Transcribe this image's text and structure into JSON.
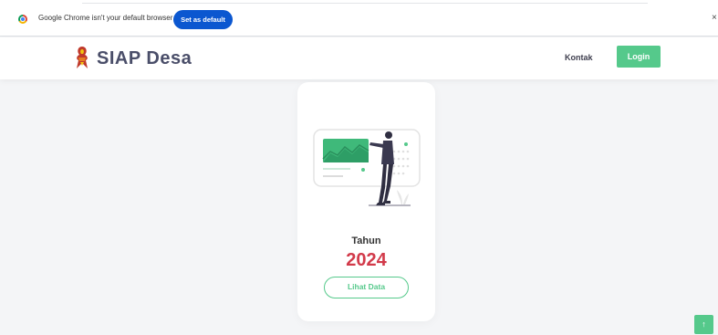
{
  "infobar": {
    "message": "Google Chrome isn't your default browser",
    "set_default_label": "Set as default",
    "close_glyph": "×",
    "icon": "chrome-icon"
  },
  "header": {
    "brand": "SIAP Desa",
    "logo_icon": "garuda-logo-icon",
    "nav_kontak": "Kontak",
    "login_label": "Login"
  },
  "card": {
    "label": "Tahun",
    "year": "2024",
    "button_label": "Lihat Data",
    "illustration": "presentation-illustration"
  },
  "scroll_top": {
    "glyph": "↑",
    "icon": "arrow-up-icon"
  },
  "colors": {
    "accent_green": "#55c98b",
    "year_red": "#d23a4a",
    "brand_text": "#4a4e69",
    "chrome_blue": "#0b57d0"
  }
}
